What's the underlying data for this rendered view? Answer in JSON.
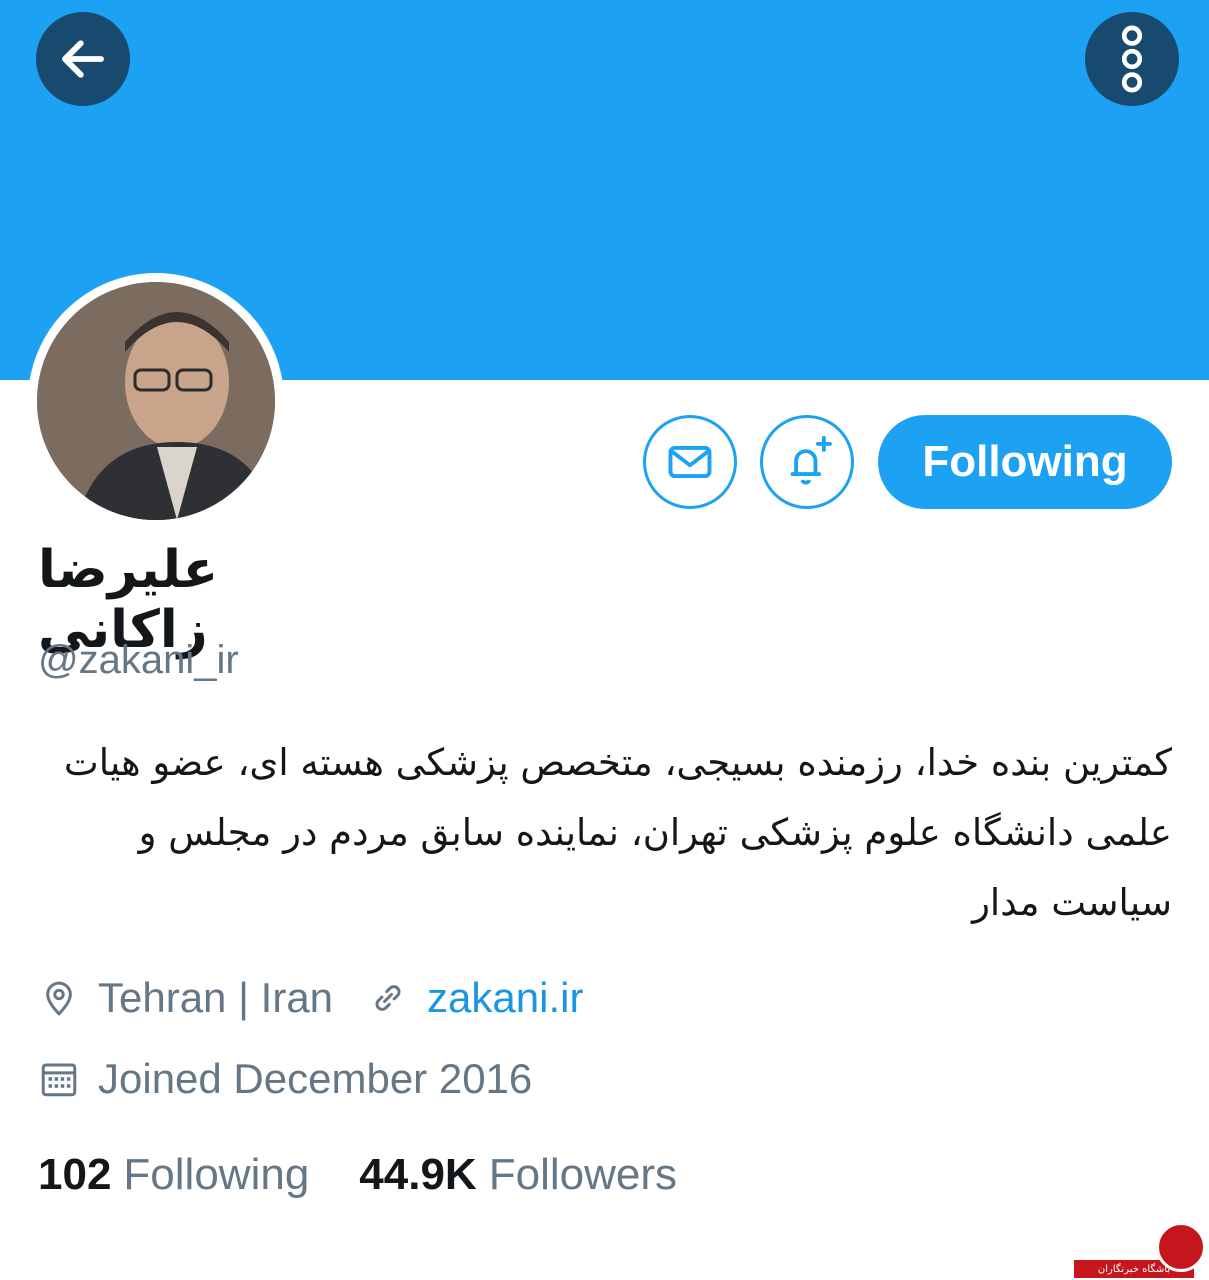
{
  "profile": {
    "display_name": "علیرضا زاکانی",
    "handle": "@zakani_ir",
    "bio": "کمترین بنده خدا، رزمنده بسیجی، متخصص پزشکی هسته ای، عضو هیات علمی دانشگاه علوم پزشکی تهران، نماینده سابق مردم در مجلس و سیاست مدار",
    "location": "Tehran | Iran",
    "website": "zakani.ir",
    "joined": "Joined December 2016"
  },
  "actions": {
    "following_label": "Following"
  },
  "stats": {
    "following_count": "102",
    "following_label": "Following",
    "followers_count": "44.9K",
    "followers_label": "Followers"
  },
  "icons": {
    "back": "arrow-left-icon",
    "more": "vertical-dots-icon",
    "message": "mail-icon",
    "notifications": "bell-plus-icon",
    "location": "location-pin-icon",
    "link": "link-icon",
    "calendar": "calendar-icon"
  },
  "colors": {
    "banner": "#1da1f2",
    "accent": "#1da1f2",
    "link": "#1b95e0",
    "muted": "#657786",
    "text": "#14171a"
  },
  "watermark": {
    "text": "باشگاه خبرنگاران"
  }
}
